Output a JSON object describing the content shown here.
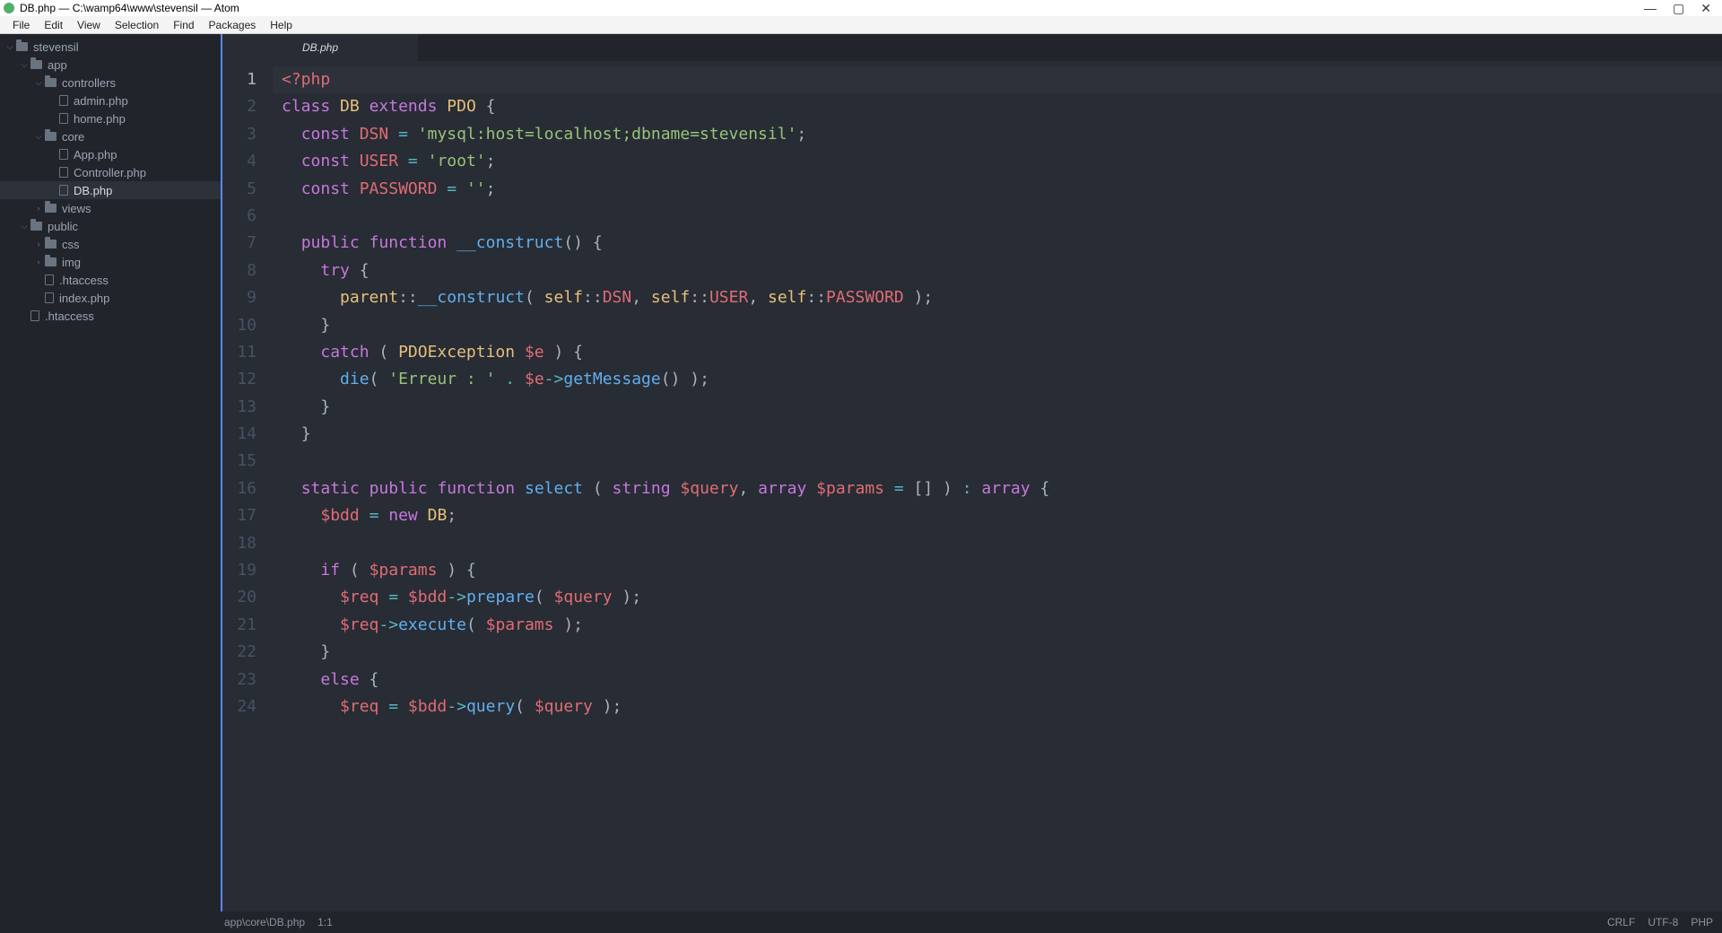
{
  "titlebar": {
    "text": "DB.php — C:\\wamp64\\www\\stevensil — Atom"
  },
  "menubar": [
    "File",
    "Edit",
    "View",
    "Selection",
    "Find",
    "Packages",
    "Help"
  ],
  "tree": [
    {
      "depth": 0,
      "type": "folder",
      "arrow": "down",
      "label": "stevensil",
      "selected": false
    },
    {
      "depth": 1,
      "type": "folder",
      "arrow": "down",
      "label": "app",
      "selected": false
    },
    {
      "depth": 2,
      "type": "folder",
      "arrow": "down",
      "label": "controllers",
      "selected": false
    },
    {
      "depth": 3,
      "type": "file",
      "arrow": "",
      "label": "admin.php",
      "selected": false
    },
    {
      "depth": 3,
      "type": "file",
      "arrow": "",
      "label": "home.php",
      "selected": false
    },
    {
      "depth": 2,
      "type": "folder",
      "arrow": "down",
      "label": "core",
      "selected": false
    },
    {
      "depth": 3,
      "type": "file",
      "arrow": "",
      "label": "App.php",
      "selected": false
    },
    {
      "depth": 3,
      "type": "file",
      "arrow": "",
      "label": "Controller.php",
      "selected": false
    },
    {
      "depth": 3,
      "type": "file",
      "arrow": "",
      "label": "DB.php",
      "selected": true
    },
    {
      "depth": 2,
      "type": "folder",
      "arrow": "right",
      "label": "views",
      "selected": false
    },
    {
      "depth": 1,
      "type": "folder",
      "arrow": "down",
      "label": "public",
      "selected": false
    },
    {
      "depth": 2,
      "type": "folder",
      "arrow": "right",
      "label": "css",
      "selected": false
    },
    {
      "depth": 2,
      "type": "folder",
      "arrow": "right",
      "label": "img",
      "selected": false
    },
    {
      "depth": 2,
      "type": "file",
      "arrow": "",
      "label": ".htaccess",
      "selected": false
    },
    {
      "depth": 2,
      "type": "file",
      "arrow": "",
      "label": "index.php",
      "selected": false
    },
    {
      "depth": 1,
      "type": "file",
      "arrow": "",
      "label": ".htaccess",
      "selected": false
    }
  ],
  "tab": {
    "label": "DB.php"
  },
  "code_lines": [
    [
      {
        "c": "tk-tag",
        "t": "<?php"
      }
    ],
    [
      {
        "c": "tk-kw",
        "t": "class "
      },
      {
        "c": "tk-cls",
        "t": "DB"
      },
      {
        "c": "tk-plain",
        "t": " "
      },
      {
        "c": "tk-kw",
        "t": "extends"
      },
      {
        "c": "tk-plain",
        "t": " "
      },
      {
        "c": "tk-cls",
        "t": "PDO"
      },
      {
        "c": "tk-punc",
        "t": " {"
      }
    ],
    [
      {
        "c": "tk-plain",
        "t": "  "
      },
      {
        "c": "tk-kw",
        "t": "const"
      },
      {
        "c": "tk-plain",
        "t": " "
      },
      {
        "c": "tk-const",
        "t": "DSN"
      },
      {
        "c": "tk-plain",
        "t": " "
      },
      {
        "c": "tk-op",
        "t": "="
      },
      {
        "c": "tk-plain",
        "t": " "
      },
      {
        "c": "tk-str",
        "t": "'mysql:host=localhost;dbname=stevensil'"
      },
      {
        "c": "tk-punc",
        "t": ";"
      }
    ],
    [
      {
        "c": "tk-plain",
        "t": "  "
      },
      {
        "c": "tk-kw",
        "t": "const"
      },
      {
        "c": "tk-plain",
        "t": " "
      },
      {
        "c": "tk-const",
        "t": "USER"
      },
      {
        "c": "tk-plain",
        "t": " "
      },
      {
        "c": "tk-op",
        "t": "="
      },
      {
        "c": "tk-plain",
        "t": " "
      },
      {
        "c": "tk-str",
        "t": "'root'"
      },
      {
        "c": "tk-punc",
        "t": ";"
      }
    ],
    [
      {
        "c": "tk-plain",
        "t": "  "
      },
      {
        "c": "tk-kw",
        "t": "const"
      },
      {
        "c": "tk-plain",
        "t": " "
      },
      {
        "c": "tk-const",
        "t": "PASSWORD"
      },
      {
        "c": "tk-plain",
        "t": " "
      },
      {
        "c": "tk-op",
        "t": "="
      },
      {
        "c": "tk-plain",
        "t": " "
      },
      {
        "c": "tk-str",
        "t": "''"
      },
      {
        "c": "tk-punc",
        "t": ";"
      }
    ],
    [],
    [
      {
        "c": "tk-plain",
        "t": "  "
      },
      {
        "c": "tk-kw",
        "t": "public"
      },
      {
        "c": "tk-plain",
        "t": " "
      },
      {
        "c": "tk-kw",
        "t": "function"
      },
      {
        "c": "tk-plain",
        "t": " "
      },
      {
        "c": "tk-fn",
        "t": "__construct"
      },
      {
        "c": "tk-punc",
        "t": "() {"
      }
    ],
    [
      {
        "c": "tk-plain",
        "t": "    "
      },
      {
        "c": "tk-kw",
        "t": "try"
      },
      {
        "c": "tk-punc",
        "t": " {"
      }
    ],
    [
      {
        "c": "tk-plain",
        "t": "      "
      },
      {
        "c": "tk-self",
        "t": "parent"
      },
      {
        "c": "tk-punc",
        "t": "::"
      },
      {
        "c": "tk-fn",
        "t": "__construct"
      },
      {
        "c": "tk-punc",
        "t": "( "
      },
      {
        "c": "tk-self",
        "t": "self"
      },
      {
        "c": "tk-punc",
        "t": "::"
      },
      {
        "c": "tk-const",
        "t": "DSN"
      },
      {
        "c": "tk-punc",
        "t": ", "
      },
      {
        "c": "tk-self",
        "t": "self"
      },
      {
        "c": "tk-punc",
        "t": "::"
      },
      {
        "c": "tk-const",
        "t": "USER"
      },
      {
        "c": "tk-punc",
        "t": ", "
      },
      {
        "c": "tk-self",
        "t": "self"
      },
      {
        "c": "tk-punc",
        "t": "::"
      },
      {
        "c": "tk-const",
        "t": "PASSWORD"
      },
      {
        "c": "tk-punc",
        "t": " );"
      }
    ],
    [
      {
        "c": "tk-plain",
        "t": "    "
      },
      {
        "c": "tk-punc",
        "t": "}"
      }
    ],
    [
      {
        "c": "tk-plain",
        "t": "    "
      },
      {
        "c": "tk-kw",
        "t": "catch"
      },
      {
        "c": "tk-punc",
        "t": " ( "
      },
      {
        "c": "tk-cls",
        "t": "PDOException"
      },
      {
        "c": "tk-plain",
        "t": " "
      },
      {
        "c": "tk-var",
        "t": "$e"
      },
      {
        "c": "tk-punc",
        "t": " ) {"
      }
    ],
    [
      {
        "c": "tk-plain",
        "t": "      "
      },
      {
        "c": "tk-fn",
        "t": "die"
      },
      {
        "c": "tk-punc",
        "t": "( "
      },
      {
        "c": "tk-str",
        "t": "'Erreur : '"
      },
      {
        "c": "tk-punc",
        "t": " "
      },
      {
        "c": "tk-op",
        "t": "."
      },
      {
        "c": "tk-punc",
        "t": " "
      },
      {
        "c": "tk-var",
        "t": "$e"
      },
      {
        "c": "tk-op",
        "t": "->"
      },
      {
        "c": "tk-fn",
        "t": "getMessage"
      },
      {
        "c": "tk-punc",
        "t": "() );"
      }
    ],
    [
      {
        "c": "tk-plain",
        "t": "    "
      },
      {
        "c": "tk-punc",
        "t": "}"
      }
    ],
    [
      {
        "c": "tk-plain",
        "t": "  "
      },
      {
        "c": "tk-punc",
        "t": "}"
      }
    ],
    [],
    [
      {
        "c": "tk-plain",
        "t": "  "
      },
      {
        "c": "tk-kw",
        "t": "static"
      },
      {
        "c": "tk-plain",
        "t": " "
      },
      {
        "c": "tk-kw",
        "t": "public"
      },
      {
        "c": "tk-plain",
        "t": " "
      },
      {
        "c": "tk-kw",
        "t": "function"
      },
      {
        "c": "tk-plain",
        "t": " "
      },
      {
        "c": "tk-fn",
        "t": "select"
      },
      {
        "c": "tk-punc",
        "t": " ( "
      },
      {
        "c": "tk-kw",
        "t": "string"
      },
      {
        "c": "tk-plain",
        "t": " "
      },
      {
        "c": "tk-var",
        "t": "$query"
      },
      {
        "c": "tk-punc",
        "t": ", "
      },
      {
        "c": "tk-kw",
        "t": "array"
      },
      {
        "c": "tk-plain",
        "t": " "
      },
      {
        "c": "tk-var",
        "t": "$params"
      },
      {
        "c": "tk-plain",
        "t": " "
      },
      {
        "c": "tk-op",
        "t": "="
      },
      {
        "c": "tk-plain",
        "t": " "
      },
      {
        "c": "tk-punc",
        "t": "[] ) "
      },
      {
        "c": "tk-op",
        "t": ":"
      },
      {
        "c": "tk-plain",
        "t": " "
      },
      {
        "c": "tk-kw",
        "t": "array"
      },
      {
        "c": "tk-punc",
        "t": " {"
      }
    ],
    [
      {
        "c": "tk-plain",
        "t": "    "
      },
      {
        "c": "tk-var",
        "t": "$bdd"
      },
      {
        "c": "tk-plain",
        "t": " "
      },
      {
        "c": "tk-op",
        "t": "="
      },
      {
        "c": "tk-plain",
        "t": " "
      },
      {
        "c": "tk-kw",
        "t": "new"
      },
      {
        "c": "tk-plain",
        "t": " "
      },
      {
        "c": "tk-cls",
        "t": "DB"
      },
      {
        "c": "tk-punc",
        "t": ";"
      }
    ],
    [],
    [
      {
        "c": "tk-plain",
        "t": "    "
      },
      {
        "c": "tk-kw",
        "t": "if"
      },
      {
        "c": "tk-punc",
        "t": " ( "
      },
      {
        "c": "tk-var",
        "t": "$params"
      },
      {
        "c": "tk-punc",
        "t": " ) {"
      }
    ],
    [
      {
        "c": "tk-plain",
        "t": "      "
      },
      {
        "c": "tk-var",
        "t": "$req"
      },
      {
        "c": "tk-plain",
        "t": " "
      },
      {
        "c": "tk-op",
        "t": "="
      },
      {
        "c": "tk-plain",
        "t": " "
      },
      {
        "c": "tk-var",
        "t": "$bdd"
      },
      {
        "c": "tk-op",
        "t": "->"
      },
      {
        "c": "tk-fn",
        "t": "prepare"
      },
      {
        "c": "tk-punc",
        "t": "( "
      },
      {
        "c": "tk-var",
        "t": "$query"
      },
      {
        "c": "tk-punc",
        "t": " );"
      }
    ],
    [
      {
        "c": "tk-plain",
        "t": "      "
      },
      {
        "c": "tk-var",
        "t": "$req"
      },
      {
        "c": "tk-op",
        "t": "->"
      },
      {
        "c": "tk-fn",
        "t": "execute"
      },
      {
        "c": "tk-punc",
        "t": "( "
      },
      {
        "c": "tk-var",
        "t": "$params"
      },
      {
        "c": "tk-punc",
        "t": " );"
      }
    ],
    [
      {
        "c": "tk-plain",
        "t": "    "
      },
      {
        "c": "tk-punc",
        "t": "}"
      }
    ],
    [
      {
        "c": "tk-plain",
        "t": "    "
      },
      {
        "c": "tk-kw",
        "t": "else"
      },
      {
        "c": "tk-punc",
        "t": " {"
      }
    ],
    [
      {
        "c": "tk-plain",
        "t": "      "
      },
      {
        "c": "tk-var",
        "t": "$req"
      },
      {
        "c": "tk-plain",
        "t": " "
      },
      {
        "c": "tk-op",
        "t": "="
      },
      {
        "c": "tk-plain",
        "t": " "
      },
      {
        "c": "tk-var",
        "t": "$bdd"
      },
      {
        "c": "tk-op",
        "t": "->"
      },
      {
        "c": "tk-fn",
        "t": "query"
      },
      {
        "c": "tk-punc",
        "t": "( "
      },
      {
        "c": "tk-var",
        "t": "$query"
      },
      {
        "c": "tk-punc",
        "t": " );"
      }
    ]
  ],
  "active_line": 1,
  "statusbar": {
    "path": "app\\core\\DB.php",
    "cursor": "1:1",
    "eol": "CRLF",
    "encoding": "UTF-8",
    "lang": "PHP"
  }
}
